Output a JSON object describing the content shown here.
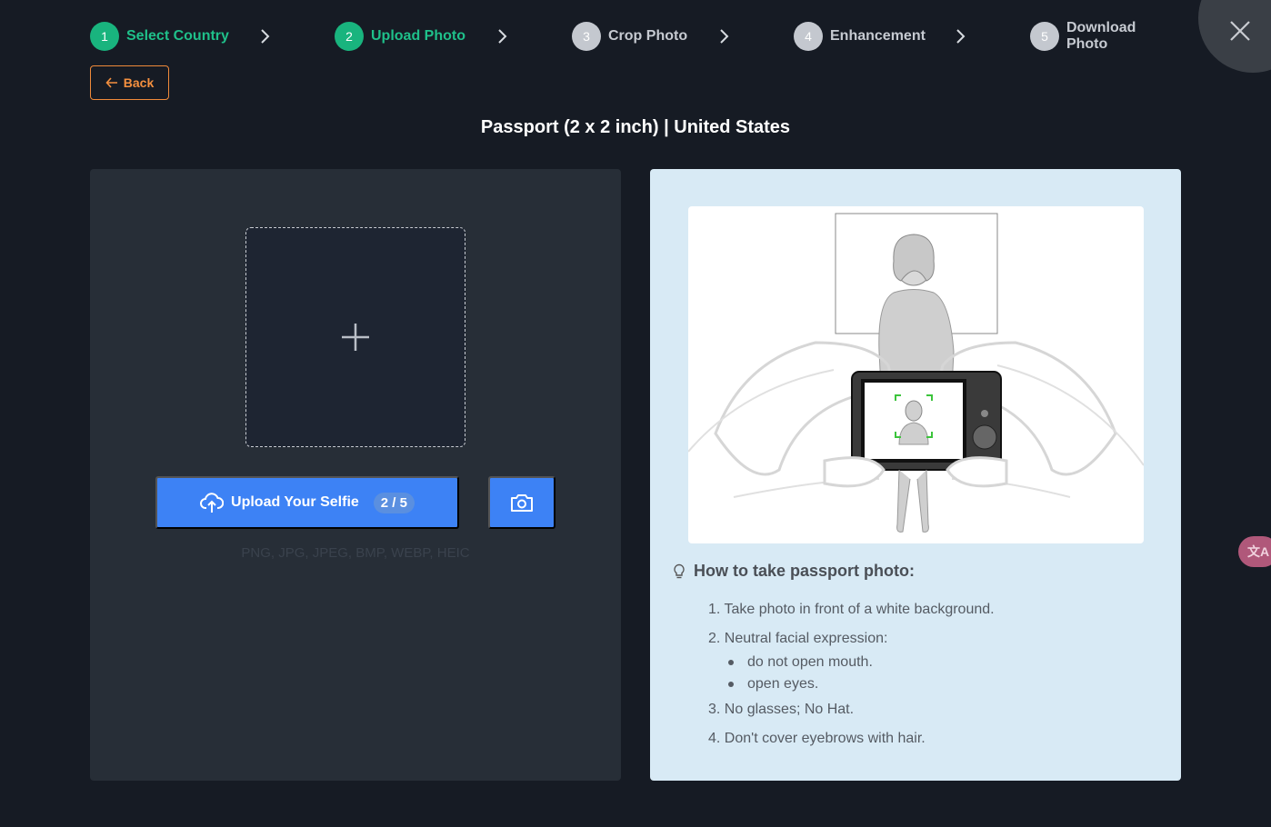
{
  "stepper": {
    "steps": [
      {
        "num": "1",
        "label": "Select Country",
        "state": "done"
      },
      {
        "num": "2",
        "label": "Upload Photo",
        "state": "done"
      },
      {
        "num": "3",
        "label": "Crop Photo",
        "state": "todo"
      },
      {
        "num": "4",
        "label": "Enhancement",
        "state": "todo"
      },
      {
        "num": "5",
        "label": "Download Photo",
        "state": "todo"
      }
    ]
  },
  "nav": {
    "back_label": "Back"
  },
  "page": {
    "title": "Passport (2 x 2 inch) | United States"
  },
  "upload": {
    "button_label": "Upload Your Selfie",
    "count": "2 / 5",
    "formats": "PNG, JPG, JPEG, BMP, WEBP, HEIC"
  },
  "guide": {
    "title": "How to take passport photo:",
    "tips": [
      "1. Take photo in front of a white background.",
      "2. Neutral facial expression:",
      "3. No glasses; No Hat.",
      "4. Don't cover eyebrows with hair."
    ],
    "sub_tips": [
      "do not open mouth.",
      "open eyes."
    ]
  },
  "translate": {
    "glyph": "文A"
  },
  "colors": {
    "accent_green": "#19b47e",
    "primary_blue": "#3d82f5",
    "back_orange": "#f08a3a",
    "background": "#161b24"
  },
  "icons": [
    "chevron-right-icon",
    "close-icon",
    "arrow-left-icon",
    "plus-icon",
    "cloud-upload-icon",
    "camera-icon",
    "lightbulb-icon",
    "translate-icon"
  ]
}
